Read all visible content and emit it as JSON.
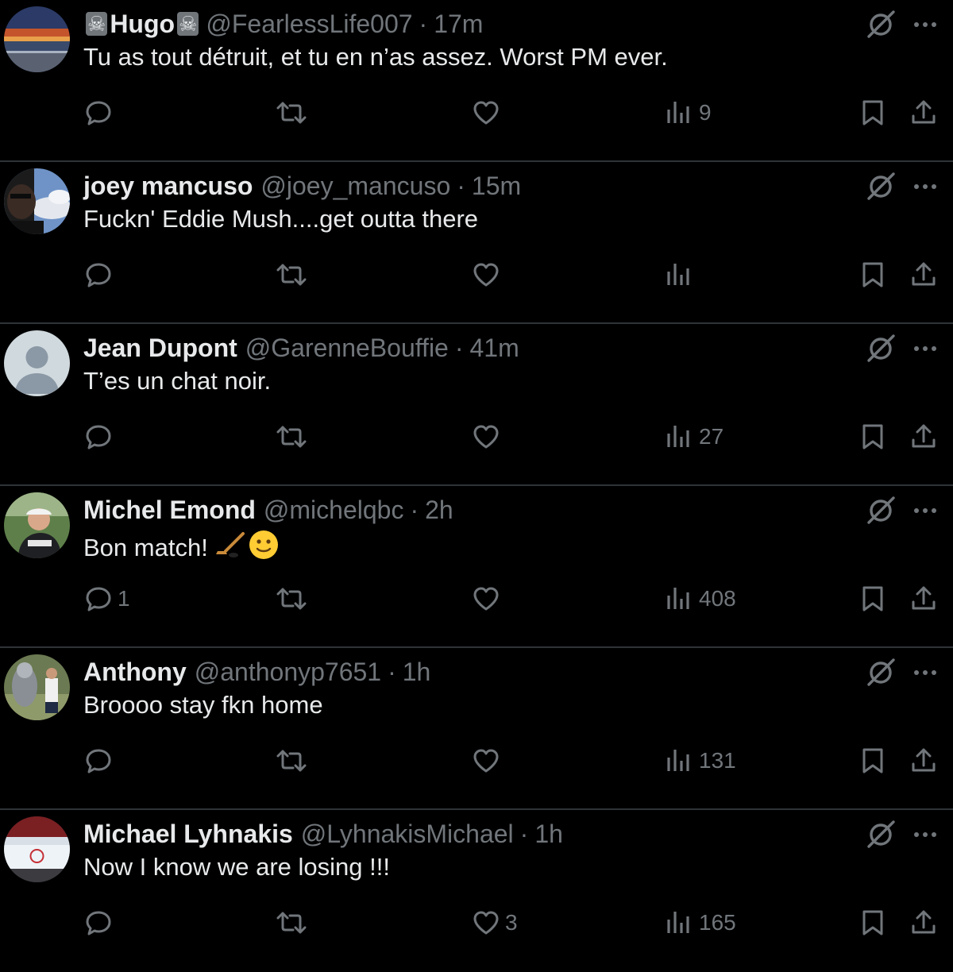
{
  "colors": {
    "background": "#000000",
    "primary_text": "#e7e9ea",
    "secondary_text": "#71767b",
    "divider": "#2f3336"
  },
  "tweets": [
    {
      "name": "Hugo",
      "name_decoration": "☠",
      "handle": "@FearlessLife007",
      "separator": "·",
      "time": "17m",
      "text": "Tu as tout détruit, et tu en n’as assez. Worst PM ever.",
      "replies": "",
      "retweets": "",
      "likes": "",
      "views": "9",
      "avatar": "sunset-road-photo"
    },
    {
      "name": "joey mancuso",
      "handle": "@joey_mancuso",
      "separator": "·",
      "time": "15m",
      "text": "Fuckn' Eddie Mush....get outta there",
      "replies": "",
      "retweets": "",
      "likes": "",
      "views": "",
      "avatar": "selfie-sky-photo"
    },
    {
      "name": "Jean Dupont",
      "handle": "@GarenneBouffie",
      "separator": "·",
      "time": "41m",
      "text": "T’es un chat noir.",
      "replies": "",
      "retweets": "",
      "likes": "",
      "views": "27",
      "avatar": "default-profile"
    },
    {
      "name": "Michel Emond",
      "handle": "@michelqbc",
      "separator": "·",
      "time": "2h",
      "text": "Bon match!",
      "emojis": [
        "hockey-stick-emoji",
        "slightly-smiling-face-emoji"
      ],
      "replies": "1",
      "retweets": "",
      "likes": "",
      "views": "408",
      "avatar": "man-with-cap-photo"
    },
    {
      "name": "Anthony",
      "handle": "@anthonyp7651",
      "separator": "·",
      "time": "1h",
      "text": "Broooo stay fkn home",
      "replies": "",
      "retweets": "",
      "likes": "",
      "views": "131",
      "avatar": "statue-photo"
    },
    {
      "name": "Michael Lyhnakis",
      "handle": "@LyhnakisMichael",
      "separator": "·",
      "time": "1h",
      "text": "Now I know we are losing !!!",
      "replies": "",
      "retweets": "",
      "likes": "3",
      "views": "165",
      "avatar": "hockey-arena-photo"
    }
  ]
}
